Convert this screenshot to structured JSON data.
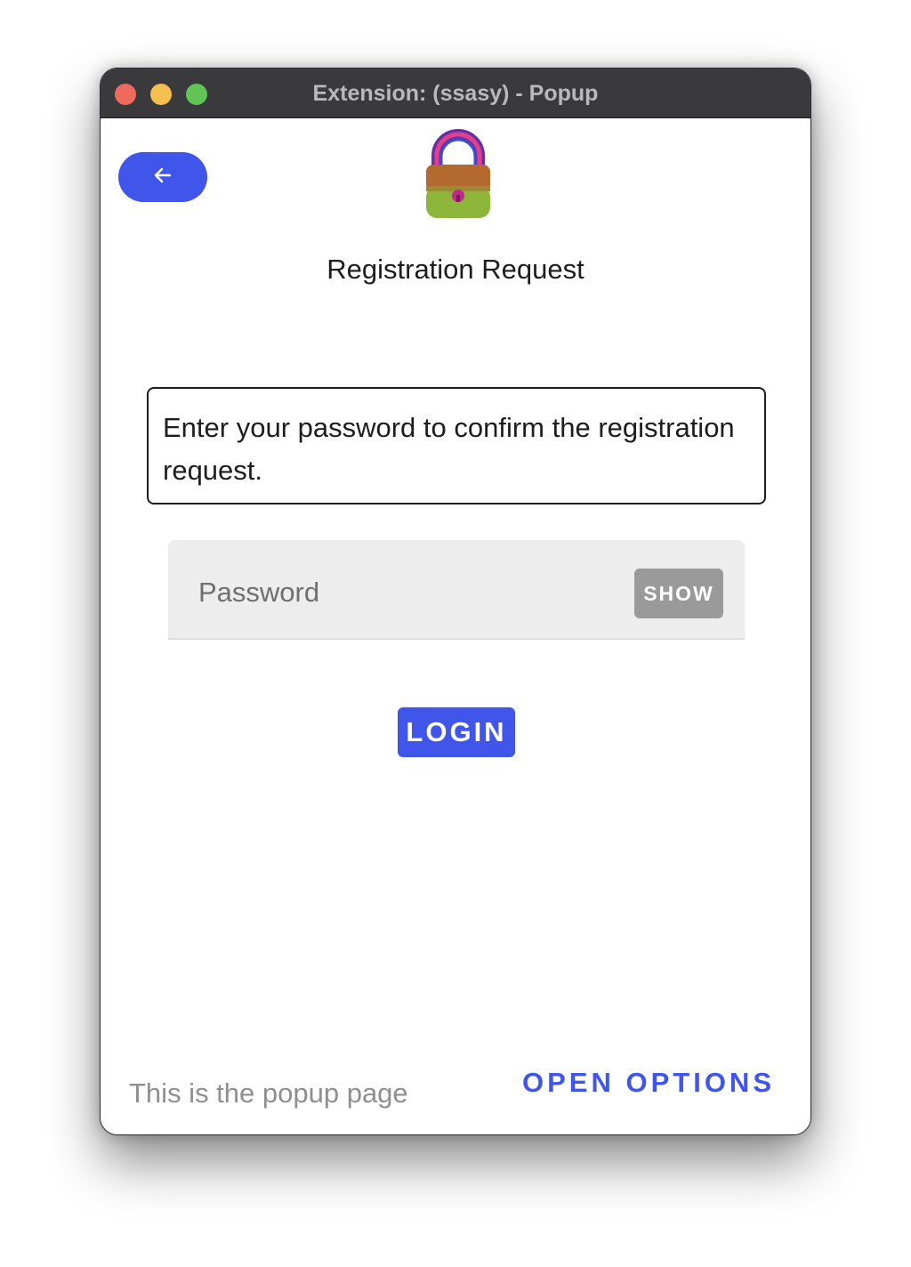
{
  "window": {
    "title": "Extension: (ssasy) - Popup"
  },
  "header": {
    "back_icon": "arrow-left-icon",
    "logo_icon": "padlock-icon",
    "title": "Registration Request"
  },
  "message": {
    "text": "Enter your password to confirm the registration request."
  },
  "password": {
    "placeholder": "Password",
    "value": "",
    "show_label": "SHOW"
  },
  "actions": {
    "login_label": "LOGIN"
  },
  "footer": {
    "text": "This is the popup page",
    "options_label": "OPEN OPTIONS"
  },
  "colors": {
    "accent": "#4055e9",
    "titlebar": "#3a3a3d",
    "field_bg": "#ededed",
    "show_button": "#9a9a9a"
  }
}
